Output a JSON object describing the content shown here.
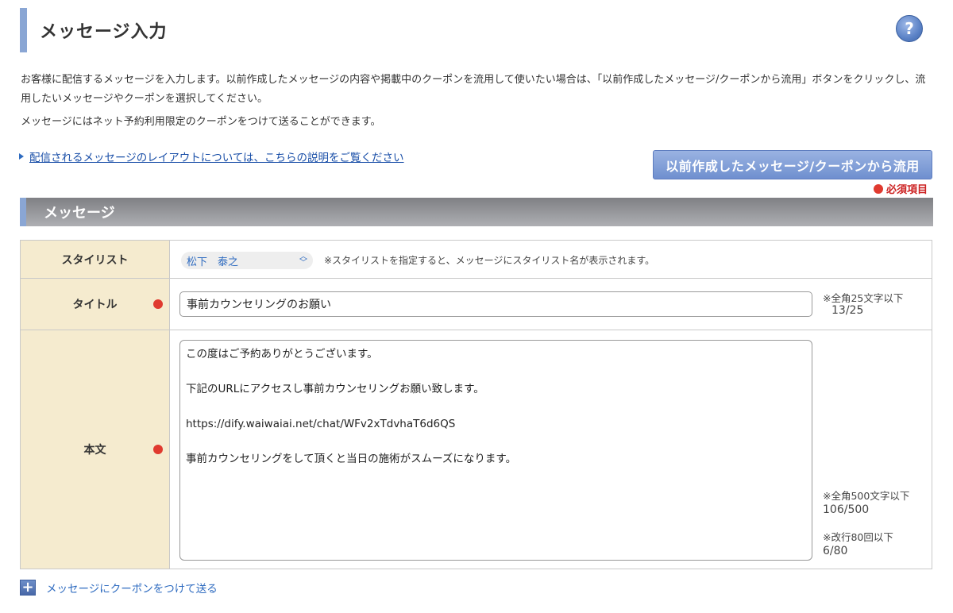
{
  "header": {
    "title": "メッセージ入力",
    "help_label": "?"
  },
  "description": {
    "line1": "お客様に配信するメッセージを入力します。以前作成したメッセージの内容や掲載中のクーポンを流用して使いたい場合は、「以前作成したメッセージ/クーポンから流用」ボタンをクリックし、流用したいメッセージやクーポンを選択してください。",
    "line2": "メッセージにはネット予約利用限定のクーポンをつけて送ることができます。"
  },
  "layout_link": "配信されるメッセージのレイアウトについては、こちらの説明をご覧ください",
  "reuse_button": "以前作成したメッセージ/クーポンから流用",
  "required_note": "必須項目",
  "section_title": "メッセージ",
  "form": {
    "stylist": {
      "label": "スタイリスト",
      "selected": "松下　泰之",
      "note": "※スタイリストを指定すると、メッセージにスタイリスト名が表示されます。"
    },
    "title": {
      "label": "タイトル",
      "value": "事前カウンセリングのお願い",
      "limit_note": "※全角25文字以下",
      "count": "13/25"
    },
    "body": {
      "label": "本文",
      "lines": [
        "この度はご予約ありがとうございます。",
        "下記のURLにアクセスし事前カウンセリングお願い致します。",
        "https://dify.waiwaiai.net/chat/WFv2xTdvhaT6d6QS",
        "事前カウンセリングをして頂くと当日の施術がスムーズになります。"
      ],
      "char_limit_note": "※全角500文字以下",
      "char_count": "106/500",
      "newline_limit_note": "※改行80回以下",
      "newline_count": "6/80"
    }
  },
  "coupon_link": "メッセージにクーポンをつけて送る",
  "colors": {
    "accent_blue": "#8aa6d4",
    "label_bg": "#f5ebcf",
    "required_red": "#e03a2f",
    "link_blue": "#2e6bc0"
  }
}
